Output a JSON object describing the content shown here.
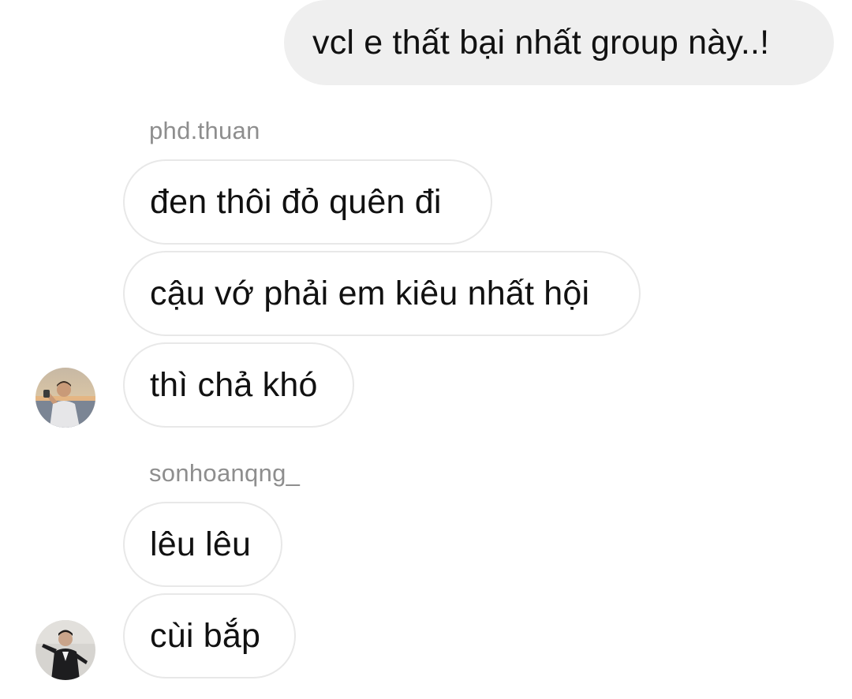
{
  "thread": {
    "outgoing_1": "vcl e thất bại nhất group này..!",
    "sender_1": "phd.thuan",
    "msg_1a": "đen thôi đỏ quên đi",
    "msg_1b": "cậu vớ phải em kiêu nhất hội",
    "msg_1c": "thì chả khó",
    "sender_2": "sonhoanqng_",
    "msg_2a": "lêu lêu",
    "msg_2b": "cùi bắp"
  },
  "avatars": {
    "user_1": "user-photo-avatar",
    "user_2": "user-photo-avatar"
  },
  "colors": {
    "outgoing_bubble": "#efefef",
    "incoming_border": "#e8e8e8",
    "sender_label": "#8e8e8e",
    "text": "#111111"
  }
}
